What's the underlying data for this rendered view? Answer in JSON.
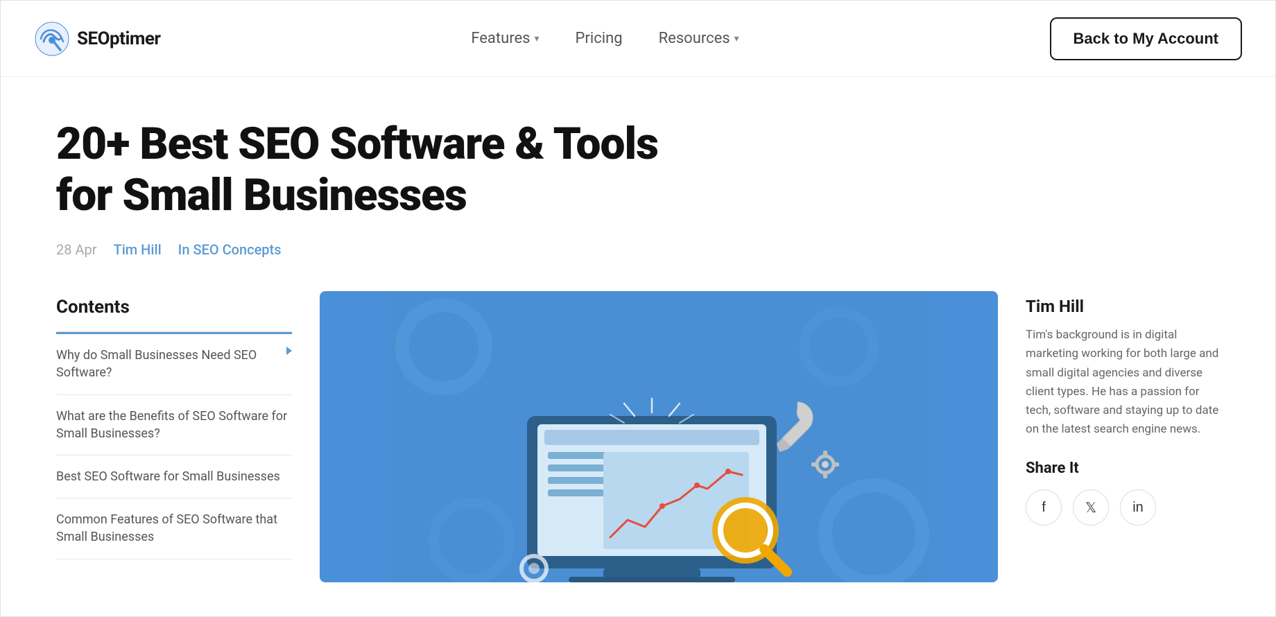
{
  "brand": {
    "name": "SEOptimer",
    "logo_alt": "SEOptimer logo"
  },
  "navbar": {
    "features_label": "Features",
    "pricing_label": "Pricing",
    "resources_label": "Resources",
    "back_button_label": "Back to My Account"
  },
  "article": {
    "title": "20+ Best SEO Software & Tools for Small Businesses",
    "date": "28 Apr",
    "author": "Tim Hill",
    "category": "In SEO Concepts"
  },
  "toc": {
    "title": "Contents",
    "items": [
      "Why do Small Businesses Need SEO Software?",
      "What are the Benefits of SEO Software for Small Businesses?",
      "Best SEO Software for Small Businesses",
      "Common Features of SEO Software that Small Businesses"
    ]
  },
  "author_sidebar": {
    "name": "Tim Hill",
    "bio": "Tim's background is in digital marketing working for both large and small digital agencies and diverse client types. He has a passion for tech, software and staying up to date on the latest search engine news.",
    "share_label": "Share It"
  },
  "social": {
    "facebook_label": "f",
    "twitter_label": "𝕏",
    "linkedin_label": "in"
  },
  "colors": {
    "accent_blue": "#5b9bd5",
    "hero_bg": "#4a8fd4",
    "dark": "#1a1a1a"
  }
}
